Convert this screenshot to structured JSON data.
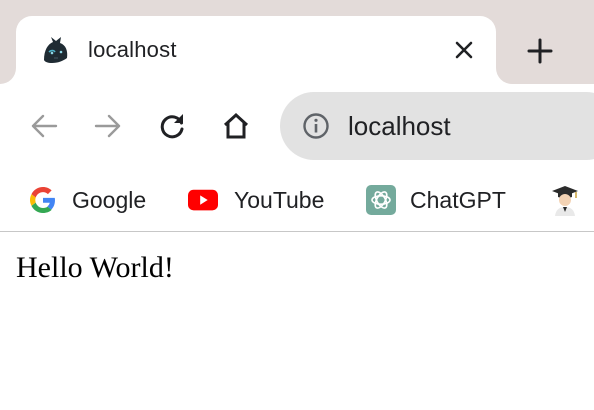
{
  "tab": {
    "title": "localhost",
    "favicon_icon": "panther-icon",
    "close_icon": "close-icon"
  },
  "tabstrip": {
    "new_tab_icon": "plus-icon"
  },
  "toolbar": {
    "back_icon": "arrow-left-icon",
    "forward_icon": "arrow-right-icon",
    "reload_icon": "reload-icon",
    "home_icon": "home-icon",
    "site_info_icon": "info-icon",
    "url": "localhost"
  },
  "bookmarks": [
    {
      "label": "Google",
      "icon": "google-icon"
    },
    {
      "label": "YouTube",
      "icon": "youtube-icon"
    },
    {
      "label": "ChatGPT",
      "icon": "chatgpt-icon"
    },
    {
      "label": "",
      "icon": "graduate-avatar-icon"
    }
  ],
  "page": {
    "text": "Hello World!"
  },
  "colors": {
    "tabstrip_bg": "#e3dbd9",
    "omnibox_bg": "#e2e2e2",
    "youtube_red": "#ff0000",
    "chatgpt_green": "#74aa9c"
  }
}
